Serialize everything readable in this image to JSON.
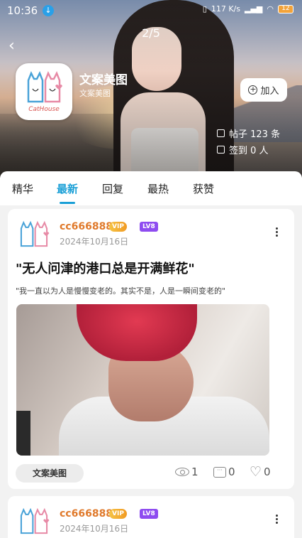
{
  "status_bar": {
    "time": "10:36",
    "net_speed": "117 K/s",
    "battery": "12"
  },
  "header": {
    "page_indicator": "2/5",
    "circle_name": "文案美图",
    "circle_subtitle": "文案美图",
    "avatar_text": "CatHouse",
    "join_label": "加入",
    "posts_label": "帖子 123 条",
    "checkin_label": "签到 0 人"
  },
  "tabs": [
    {
      "label": "精华",
      "active": false
    },
    {
      "label": "最新",
      "active": true
    },
    {
      "label": "回复",
      "active": false
    },
    {
      "label": "最热",
      "active": false
    },
    {
      "label": "获赞",
      "active": false
    }
  ],
  "posts": [
    {
      "author": "cc666888",
      "vip": "VIP",
      "level": "LV8",
      "date": "2024年10月16日",
      "title": "\"无人问津的港口总是开满鲜花\"",
      "text": "\"我一直以为人是慢慢变老的。其实不是，人是一瞬间变老的\"",
      "tag": "文案美图",
      "views": "1",
      "comments": "0",
      "likes": "0"
    },
    {
      "author": "cc666888",
      "vip": "VIP",
      "level": "LV8",
      "date": "2024年10月16日"
    }
  ],
  "colors": {
    "accent": "#1a9fd6",
    "username": "#e07a2c",
    "level_badge": "#8e4cf0"
  }
}
